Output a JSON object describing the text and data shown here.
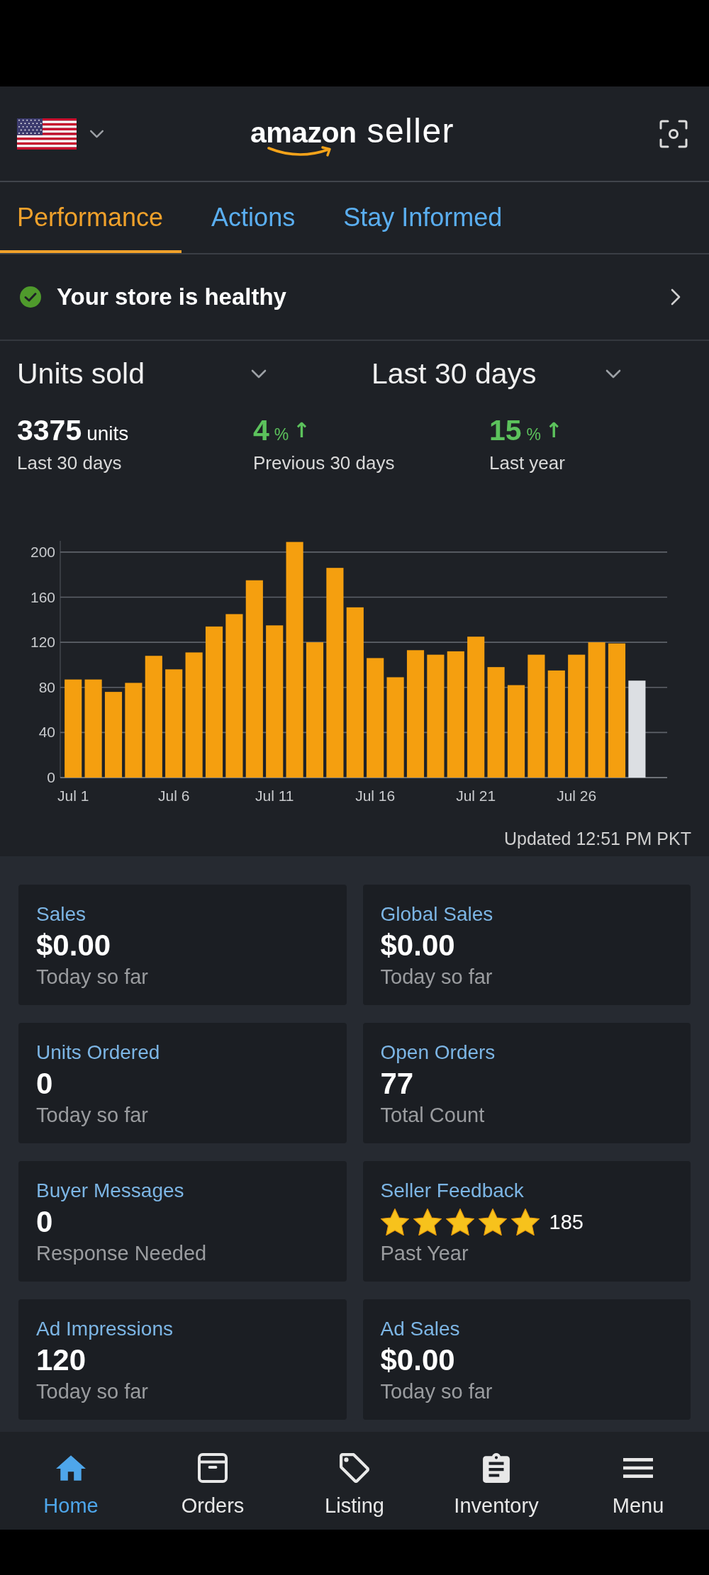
{
  "header": {
    "logo": {
      "brand": "amazon",
      "product": "seller"
    }
  },
  "tabs": [
    {
      "label": "Performance",
      "selected": true
    },
    {
      "label": "Actions",
      "selected": false
    },
    {
      "label": "Stay Informed",
      "selected": false
    }
  ],
  "health_banner": {
    "text": "Your store is healthy"
  },
  "selectors": [
    {
      "value": "Units sold"
    },
    {
      "value": "Last 30 days"
    }
  ],
  "stats": [
    {
      "kind": "total",
      "value": "3375",
      "unit": "units",
      "label": "Last 30 days"
    },
    {
      "kind": "change",
      "value": "4",
      "unit": "%",
      "arrow": "↑",
      "label": "Previous 30 days"
    },
    {
      "kind": "change",
      "value": "15",
      "unit": "%",
      "arrow": "↑",
      "label": "Last year"
    }
  ],
  "chart": {
    "chart_data": {
      "type": "bar",
      "categories": [
        "Jul 1",
        null,
        null,
        null,
        null,
        "Jul 6",
        null,
        null,
        null,
        null,
        "Jul 11",
        null,
        null,
        null,
        null,
        "Jul 16",
        null,
        null,
        null,
        null,
        "Jul 21",
        null,
        null,
        null,
        null,
        "Jul 26",
        null,
        null,
        null
      ],
      "series": [
        {
          "color": "#f59f0f",
          "values": [
            87,
            87,
            76,
            84,
            108,
            96,
            111,
            134,
            145,
            175,
            135,
            209,
            120,
            186,
            151,
            106,
            89,
            113,
            109,
            112,
            125,
            98,
            82,
            109,
            95,
            109,
            120,
            119,
            null
          ]
        },
        {
          "color": "#dcdfe3",
          "values": [
            null,
            null,
            null,
            null,
            null,
            null,
            null,
            null,
            null,
            null,
            null,
            null,
            null,
            null,
            null,
            null,
            null,
            null,
            null,
            null,
            null,
            null,
            null,
            null,
            null,
            null,
            null,
            null,
            86
          ]
        }
      ],
      "ylim": [
        0,
        210
      ],
      "yticks": [
        0,
        40,
        80,
        120,
        160,
        200
      ],
      "grid": true
    },
    "updated": "Updated 12:51 PM PKT"
  },
  "cards": [
    {
      "kind": "amount",
      "title": "Sales",
      "value": "$0.00",
      "note": "Today so far"
    },
    {
      "kind": "amount",
      "title": "Global Sales",
      "value": "$0.00",
      "note": "Today so far"
    },
    {
      "kind": "amount",
      "title": "Units Ordered",
      "value": "0",
      "note": "Today so far"
    },
    {
      "kind": "amount",
      "title": "Open Orders",
      "value": "77",
      "note": "Total Count"
    },
    {
      "kind": "amount",
      "title": "Buyer Messages",
      "value": "0",
      "note": "Response Needed"
    },
    {
      "kind": "rating",
      "title": "Seller Feedback",
      "stars": 5,
      "value": "185",
      "note": "Past Year"
    },
    {
      "kind": "amount",
      "title": "Ad Impressions",
      "value": "120",
      "note": "Today so far"
    },
    {
      "kind": "amount",
      "title": "Ad Sales",
      "value": "$0.00",
      "note": "Today so far"
    }
  ],
  "bottom_nav": [
    {
      "label": "Home",
      "selected": true
    },
    {
      "label": "Orders",
      "selected": false
    },
    {
      "label": "Listing",
      "selected": false
    },
    {
      "label": "Inventory",
      "selected": false
    },
    {
      "label": "Menu",
      "selected": false
    }
  ]
}
